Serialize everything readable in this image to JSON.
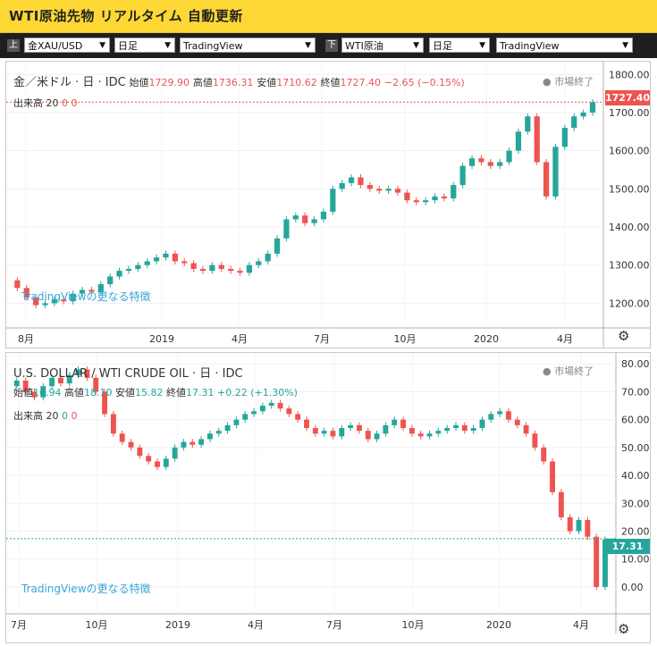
{
  "title": "WTI原油先物 リアルタイム 自動更新",
  "toolbar": {
    "upper_label": "上",
    "upper_symbol": "金XAU/USD",
    "upper_period": "日足",
    "upper_source": "TradingView",
    "lower_label": "下",
    "lower_symbol": "WTI原油",
    "lower_period": "日足",
    "lower_source": "TradingView"
  },
  "top_chart": {
    "symbol": "金／米ドル · 日 · IDC",
    "open_label": "始値",
    "open": "1729.90",
    "high_label": "高値",
    "high": "1736.31",
    "low_label": "安値",
    "low": "1710.62",
    "close_label": "終値",
    "close": "1727.40",
    "change": "−2.65 (−0.15%)",
    "status": "● 市場終了",
    "volume": "出来高 20",
    "vol_a": "0",
    "vol_b": "0",
    "watermark": "TradingViewの更なる特徴",
    "last_price": "1727.40",
    "color": "#ef5350"
  },
  "bottom_chart": {
    "symbol": "U.S. DOLLAR / WTI CRUDE OIL · 日 · IDC",
    "open_label": "始値",
    "open": "16.94",
    "high_label": "高値",
    "high": "18.10",
    "low_label": "安値",
    "low": "15.82",
    "close_label": "終値",
    "close": "17.31",
    "change": "+0.22 (+1.30%)",
    "status": "● 市場終了",
    "volume": "出来高 20",
    "vol_a": "0",
    "vol_b": "0",
    "watermark": "TradingViewの更なる特徴",
    "last_price": "17.31",
    "color": "#26a69a"
  },
  "chart_data": [
    {
      "type": "line",
      "title": "金／米ドル · 日 · IDC",
      "x_ticks": [
        "8月",
        "2019",
        "4月",
        "7月",
        "10月",
        "2020",
        "4月"
      ],
      "y_ticks": [
        "1200.00",
        "1300.00",
        "1400.00",
        "1500.00",
        "1600.00",
        "1700.00",
        "1800.00"
      ],
      "ylim": [
        1140,
        1810
      ],
      "series": [
        {
          "values": [
            1260,
            1240,
            1215,
            1195,
            1200,
            1210,
            1205,
            1225,
            1235,
            1230,
            1250,
            1270,
            1285,
            1290,
            1300,
            1310,
            1320,
            1330,
            1310,
            1305,
            1290,
            1285,
            1300,
            1290,
            1285,
            1280,
            1300,
            1310,
            1330,
            1370,
            1420,
            1430,
            1410,
            1420,
            1440,
            1500,
            1515,
            1530,
            1510,
            1500,
            1495,
            1500,
            1490,
            1470,
            1465,
            1470,
            1480,
            1475,
            1510,
            1560,
            1580,
            1570,
            1560,
            1570,
            1600,
            1650,
            1690,
            1570,
            1480,
            1610,
            1660,
            1690,
            1700,
            1727
          ]
        }
      ],
      "last_value": 1727.4
    },
    {
      "type": "line",
      "title": "U.S. DOLLAR / WTI CRUDE OIL · 日 · IDC",
      "x_ticks": [
        "7月",
        "10月",
        "2019",
        "4月",
        "7月",
        "10月",
        "2020",
        "4月"
      ],
      "y_ticks": [
        "0.00",
        "10.00",
        "20.00",
        "30.00",
        "40.00",
        "50.00",
        "60.00",
        "70.00",
        "80.00"
      ],
      "ylim": [
        -9,
        82
      ],
      "series": [
        {
          "values": [
            72,
            74,
            70,
            68,
            72,
            75,
            73,
            76,
            78,
            75,
            70,
            62,
            55,
            52,
            50,
            47,
            45,
            43,
            46,
            50,
            52,
            51,
            53,
            55,
            56,
            58,
            60,
            62,
            63,
            65,
            66,
            64,
            62,
            60,
            57,
            55,
            56,
            54,
            57,
            58,
            56,
            53,
            55,
            58,
            60,
            57,
            55,
            54,
            55,
            56,
            57,
            58,
            56,
            57,
            60,
            62,
            63,
            60,
            58,
            55,
            50,
            45,
            34,
            25,
            20,
            24,
            18,
            0,
            17
          ]
        }
      ],
      "last_value": 17.31
    }
  ]
}
